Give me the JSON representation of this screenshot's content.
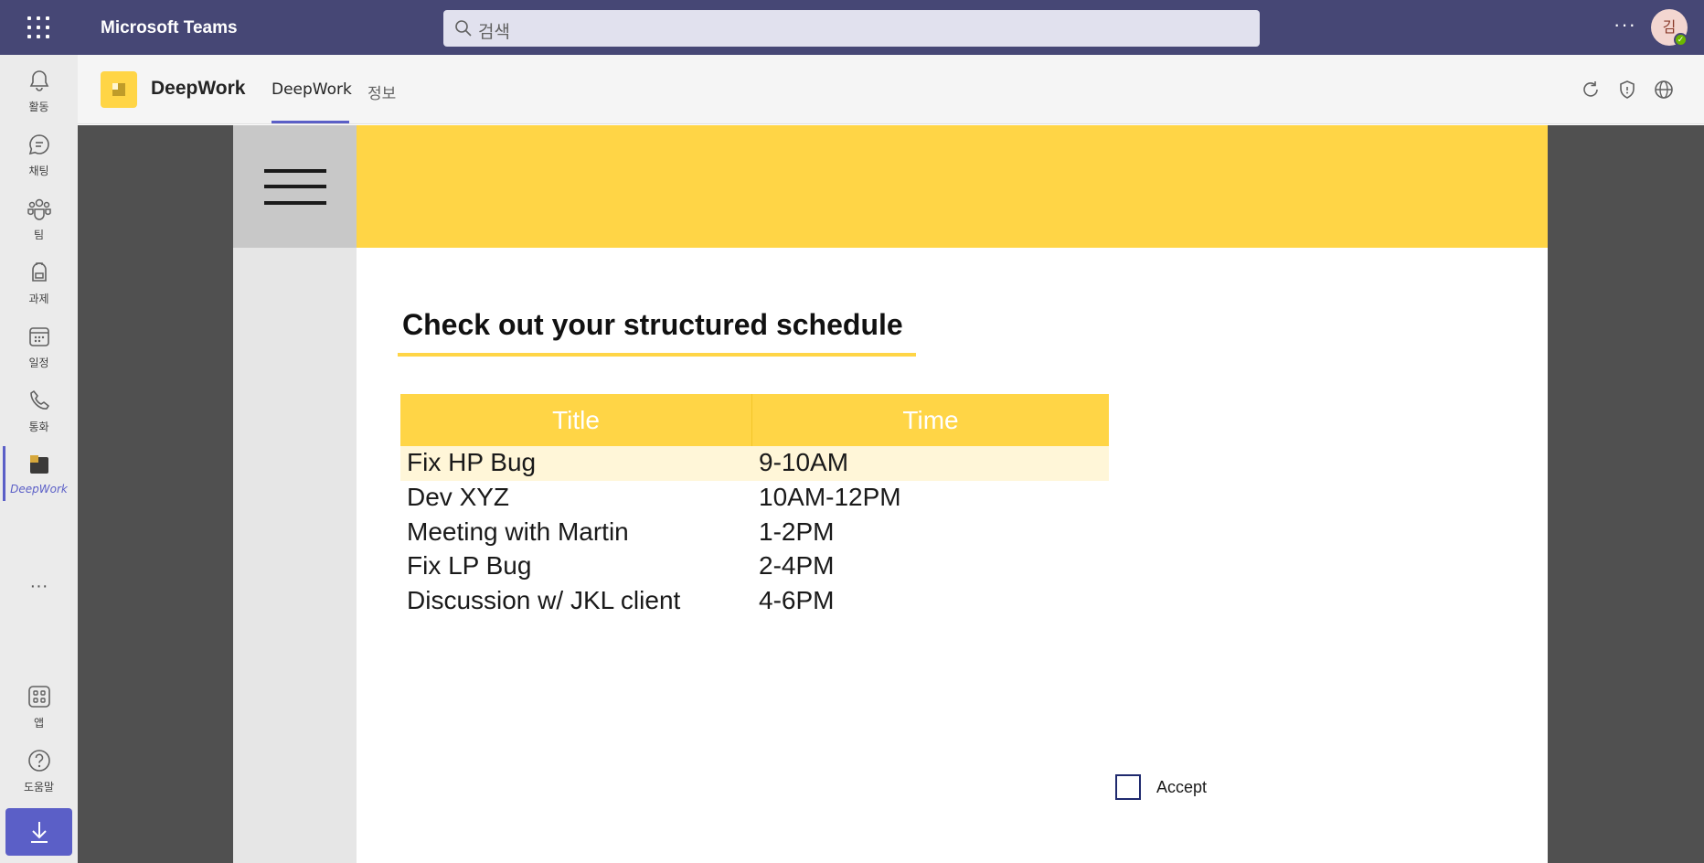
{
  "topbar": {
    "app_title": "Microsoft Teams",
    "search_placeholder": "검색",
    "more_label": "···",
    "avatar_initial": "김",
    "background_color": "#464775"
  },
  "rail": {
    "items": [
      {
        "label": "활동",
        "icon": "bell-icon"
      },
      {
        "label": "채팅",
        "icon": "chat-icon"
      },
      {
        "label": "팀",
        "icon": "teams-icon"
      },
      {
        "label": "과제",
        "icon": "backpack-icon"
      },
      {
        "label": "일정",
        "icon": "calendar-icon"
      },
      {
        "label": "통화",
        "icon": "phone-icon"
      },
      {
        "label": "DeepWork",
        "icon": "deepwork-app-icon",
        "active": true
      }
    ],
    "more_label": "···",
    "bottom_items": [
      {
        "label": "앱",
        "icon": "apps-icon"
      },
      {
        "label": "도움말",
        "icon": "help-icon"
      }
    ],
    "download_icon": "download-icon"
  },
  "app_header": {
    "app_name": "DeepWork",
    "tabs": [
      {
        "label": "DeepWork",
        "active": true
      },
      {
        "label": "정보",
        "active": false
      }
    ],
    "icons": [
      "refresh-icon",
      "shield-icon",
      "globe-icon"
    ]
  },
  "deepwork": {
    "accent_color": "#ffd546",
    "heading": "Check out your structured schedule",
    "table": {
      "columns": [
        "Title",
        "Time"
      ],
      "rows": [
        {
          "title": "Fix HP Bug",
          "time": "9-10AM",
          "selected": true
        },
        {
          "title": "Dev XYZ",
          "time": "10AM-12PM"
        },
        {
          "title": "Meeting with Martin",
          "time": "1-2PM"
        },
        {
          "title": "Fix LP Bug",
          "time": "2-4PM"
        },
        {
          "title": "Discussion w/ JKL client",
          "time": "4-6PM"
        }
      ]
    },
    "accept_label": "Accept",
    "accept_checked": false
  }
}
